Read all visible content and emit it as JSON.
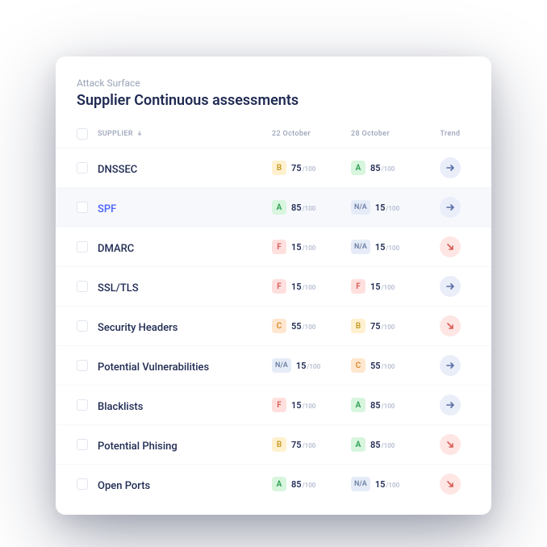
{
  "header": {
    "subtitle": "Attack Surface",
    "title": "Supplier Continuous assessments"
  },
  "columns": {
    "supplier": "SUPPLIER",
    "date1": "22 October",
    "date2": "28 October",
    "trend": "Trend"
  },
  "unit": "/100",
  "rows": [
    {
      "name": "DNSSEC",
      "active": false,
      "c1": {
        "grade": "B",
        "score": "75"
      },
      "c2": {
        "grade": "A",
        "score": "85"
      },
      "trend": "flat"
    },
    {
      "name": "SPF",
      "active": true,
      "c1": {
        "grade": "A",
        "score": "85"
      },
      "c2": {
        "grade": "NA",
        "score": "15"
      },
      "trend": "flat"
    },
    {
      "name": "DMARC",
      "active": false,
      "c1": {
        "grade": "F",
        "score": "15"
      },
      "c2": {
        "grade": "NA",
        "score": "15"
      },
      "trend": "down"
    },
    {
      "name": "SSL/TLS",
      "active": false,
      "c1": {
        "grade": "F",
        "score": "15"
      },
      "c2": {
        "grade": "F",
        "score": "15"
      },
      "trend": "flat"
    },
    {
      "name": "Security Headers",
      "active": false,
      "c1": {
        "grade": "C",
        "score": "55"
      },
      "c2": {
        "grade": "B",
        "score": "75"
      },
      "trend": "down"
    },
    {
      "name": "Potential Vulnerabilities",
      "active": false,
      "c1": {
        "grade": "NA",
        "score": "15"
      },
      "c2": {
        "grade": "C",
        "score": "55"
      },
      "trend": "flat"
    },
    {
      "name": "Blacklists",
      "active": false,
      "c1": {
        "grade": "F",
        "score": "15"
      },
      "c2": {
        "grade": "A",
        "score": "85"
      },
      "trend": "flat"
    },
    {
      "name": "Potential Phising",
      "active": false,
      "c1": {
        "grade": "B",
        "score": "75"
      },
      "c2": {
        "grade": "A",
        "score": "85"
      },
      "trend": "down"
    },
    {
      "name": "Open Ports",
      "active": false,
      "c1": {
        "grade": "A",
        "score": "85"
      },
      "c2": {
        "grade": "NA",
        "score": "15"
      },
      "trend": "down"
    }
  ],
  "gradeText": {
    "A": "A",
    "B": "B",
    "C": "C",
    "F": "F",
    "NA": "N/A"
  }
}
